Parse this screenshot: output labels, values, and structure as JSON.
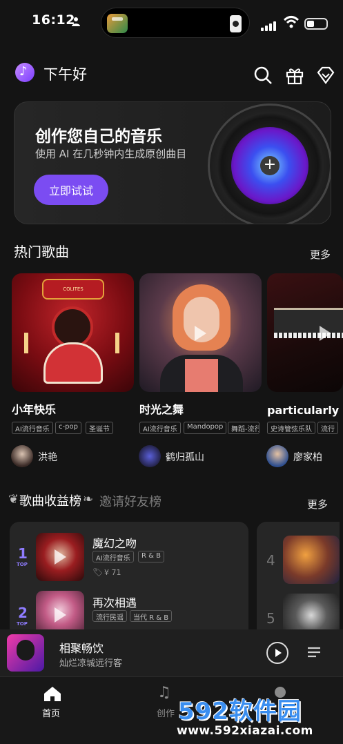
{
  "status_bar": {
    "time": "16:12"
  },
  "header": {
    "greeting": "下午好"
  },
  "banner": {
    "title": "创作您自己的音乐",
    "subtitle": "使用 AI 在几秒钟内生成原创曲目",
    "cta_label": "立即试试"
  },
  "hot_songs": {
    "title": "热门歌曲",
    "more_label": "更多",
    "items": [
      {
        "title": "小年快乐",
        "tags": [
          "AI流行音乐",
          "c-pop",
          "圣诞节"
        ],
        "author": "洪艳",
        "art_text": "COLITES"
      },
      {
        "title": "时光之舞",
        "tags": [
          "AI流行音乐",
          "Mandopop",
          "舞蹈-流行"
        ],
        "author": "鹤归孤山"
      },
      {
        "title": "particularly",
        "tags": [
          "史诗管弦乐队",
          "流行"
        ],
        "author": "廖家柏"
      }
    ]
  },
  "ranking": {
    "tab_active": "歌曲收益榜",
    "tab_inactive": "邀请好友榜",
    "more_label": "更多",
    "top_label": "TOP",
    "items": [
      {
        "rank": "1",
        "title": "魔幻之吻",
        "tags": [
          "AI流行音乐",
          "R & B"
        ],
        "price": "¥ 71"
      },
      {
        "rank": "2",
        "title": "再次相遇",
        "tags": [
          "流行民谣",
          "当代 R & B"
        ]
      }
    ],
    "side_items": [
      {
        "rank": "4"
      },
      {
        "rank": "5"
      }
    ]
  },
  "player": {
    "title": "相聚畅饮",
    "subtitle": "灿烂凉城远行客"
  },
  "nav": {
    "home_label": "首页",
    "create_label": "创作"
  },
  "watermark": {
    "brand": "592软件园",
    "url": "www.592xiazai.com"
  },
  "colors": {
    "accent": "#7b4cf2",
    "rank": "#8f7cff",
    "background": "#141414"
  }
}
